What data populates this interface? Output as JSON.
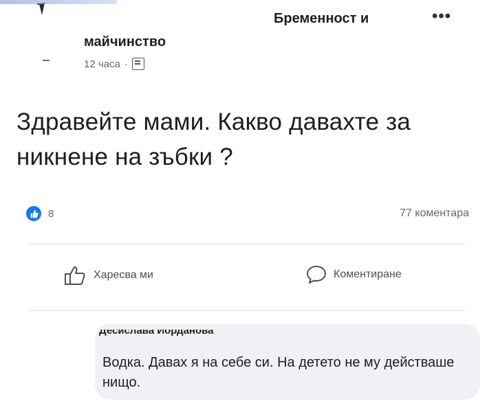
{
  "post": {
    "group_name_line1": "Бременност и",
    "group_name_line2": "майчинство",
    "timestamp": "12 часа",
    "separator": "·",
    "text": "Здравейте мами. Какво давахте за никнене на зъбки ?"
  },
  "stats": {
    "reaction_count": "8",
    "comment_count": "77 коментара"
  },
  "actions": {
    "like_label": "Харесва ми",
    "comment_label": "Коментиране"
  },
  "comment": {
    "author": "Десислава Йорданова",
    "text": "Водка. Давах я на себе си. На детето не му действаше нищо."
  },
  "colors": {
    "accent": "#1877f2",
    "comment_bg": "#eff1f4",
    "meta_text": "#65676b"
  }
}
